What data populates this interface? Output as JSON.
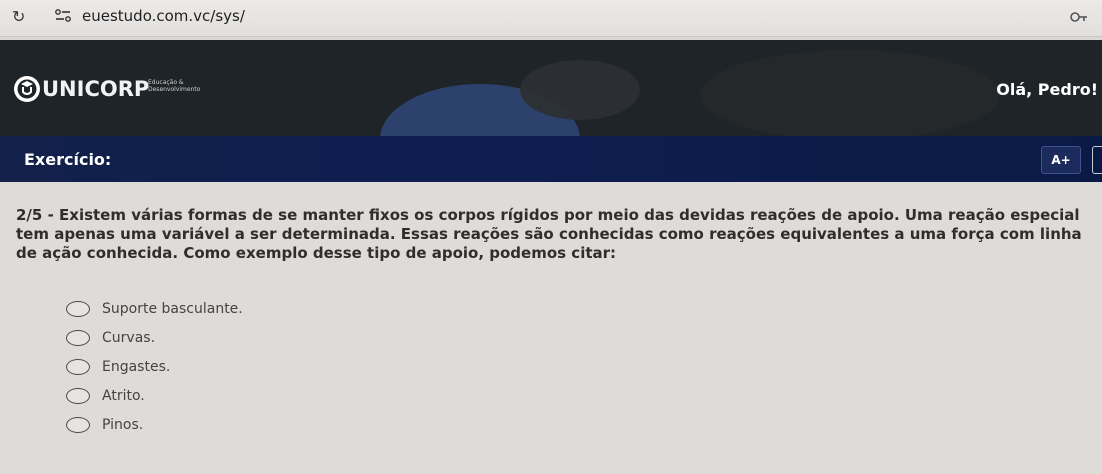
{
  "browser": {
    "url": "euestudo.com.vc/sys/",
    "icons": [
      "reload-icon",
      "site-info-icon",
      "key-icon"
    ]
  },
  "header": {
    "logo_text": "UNICORP",
    "logo_sub": "Educação & Desenvolvimento",
    "greeting": "Olá, Pedro!"
  },
  "exercise_bar": {
    "title": "Exercício:",
    "font_button": "A+"
  },
  "question": {
    "text": "2/5 - Existem várias formas de se manter fixos os corpos rígidos por meio das devidas reações de apoio. Uma reação especial tem apenas uma variável a ser determinada. Essas reações são conhecidas como reações equivalentes a uma força com linha de ação conhecida. Como exemplo desse tipo de apoio, podemos citar:"
  },
  "options": [
    {
      "label": "Suporte basculante."
    },
    {
      "label": "Curvas."
    },
    {
      "label": "Engastes."
    },
    {
      "label": "Atrito."
    },
    {
      "label": "Pinos."
    }
  ],
  "colors": {
    "header_bg": "#1f2428",
    "exercise_bar_bg": "#0e1e4f",
    "content_bg": "#dedbd8"
  }
}
